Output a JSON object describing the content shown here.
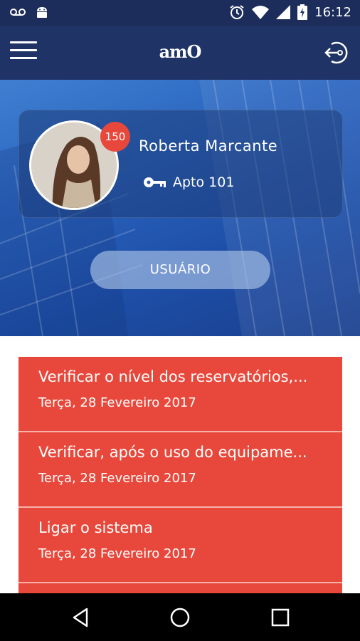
{
  "status_bar": {
    "time": "16:12",
    "icons": [
      "voicemail-icon",
      "android-icon",
      "alarm-icon",
      "wifi-icon",
      "signal-icon",
      "battery-charging-icon"
    ]
  },
  "app_bar": {
    "logo": "amO",
    "menu_icon": "hamburger-menu-icon",
    "logout_icon": "logout-icon"
  },
  "profile": {
    "name": "Roberta Marcante",
    "badge_count": "150",
    "apartment": "Apto 101",
    "key_icon": "key-icon",
    "user_button": "USUÁRIO"
  },
  "tasks": [
    {
      "title": "Verificar o nível dos reservatórios,...",
      "date": "Terça, 28 Fevereiro 2017"
    },
    {
      "title": "Verificar, após o uso do equipame...",
      "date": "Terça, 28 Fevereiro 2017"
    },
    {
      "title": "Ligar o sistema",
      "date": "Terça, 28 Fevereiro 2017"
    }
  ],
  "nav_bar": {
    "icons": [
      "back-triangle-icon",
      "home-circle-icon",
      "recents-square-icon"
    ]
  },
  "colors": {
    "app_bar": "#1f3366",
    "status_bar": "#1c2d5c",
    "accent_red": "#e8483b",
    "badge_red": "#e8473b"
  }
}
